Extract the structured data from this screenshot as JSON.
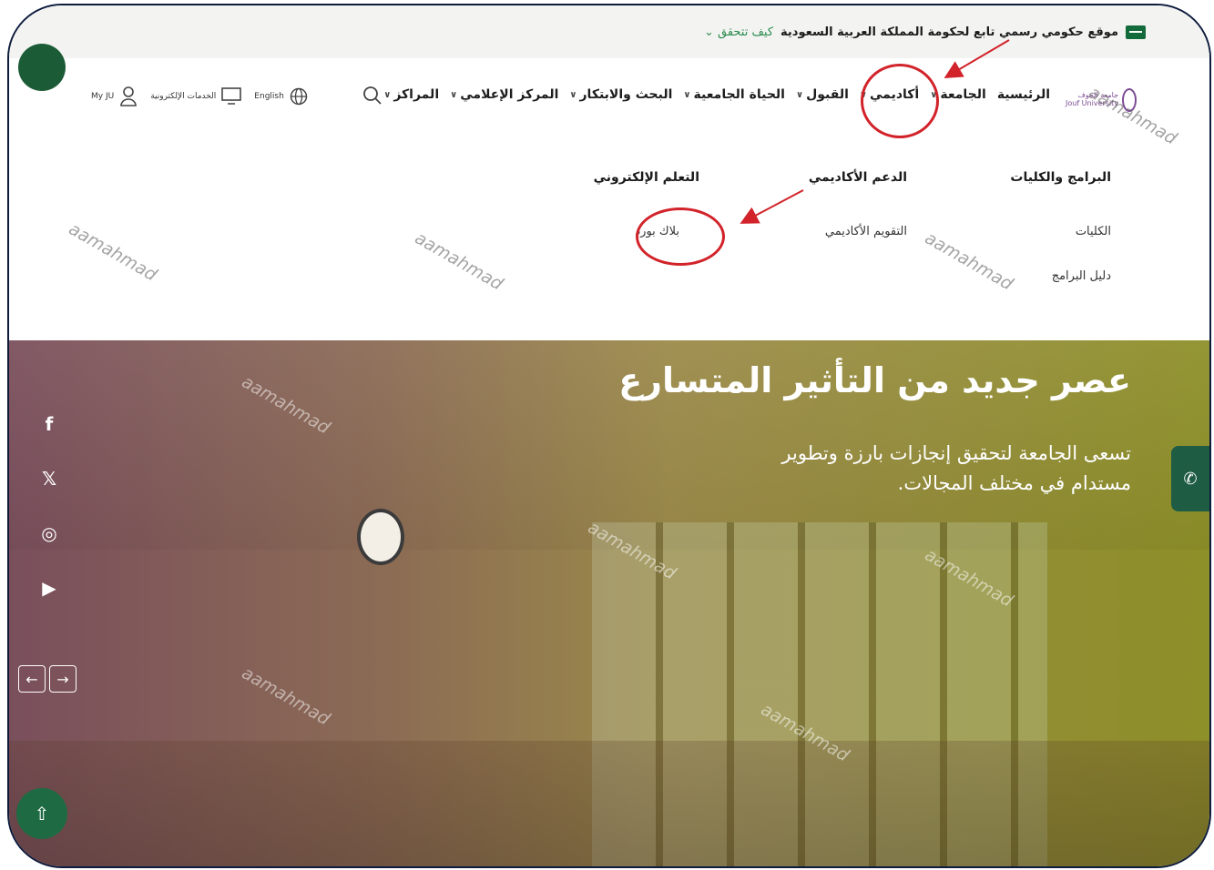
{
  "gov_bar": {
    "text": "موقع حكومي رسمي تابع لحكومة المملكة العربية السعودية",
    "link": "كيف تتحقق"
  },
  "header": {
    "logo_text": "جامعة الجوف\nJouf University",
    "nav": [
      {
        "label": "الرئيسية",
        "has_chevron": false
      },
      {
        "label": "الجامعة",
        "has_chevron": true
      },
      {
        "label": "أكاديمي",
        "has_chevron": true
      },
      {
        "label": "القبول",
        "has_chevron": true
      },
      {
        "label": "الحياة الجامعية",
        "has_chevron": true
      },
      {
        "label": "البحث والابتكار",
        "has_chevron": true
      },
      {
        "label": "المركز الإعلامي",
        "has_chevron": true
      },
      {
        "label": "المراكز",
        "has_chevron": true
      }
    ],
    "language": "English",
    "eservices": "الخدمات الإلكترونية",
    "myju": "My JU"
  },
  "mega_menu": {
    "columns": [
      {
        "title": "البرامج والكليات",
        "links": [
          "الكليات",
          "دليل البرامج"
        ]
      },
      {
        "title": "الدعم الأكاديمي",
        "links": [
          "التقويم الأكاديمي"
        ]
      },
      {
        "title": "التعلم الإلكتروني",
        "links": [
          "بلاك بورد"
        ]
      }
    ]
  },
  "hero": {
    "title": "عصر جديد من التأثير المتسارع",
    "subtitle": "تسعى الجامعة لتحقيق إنجازات بارزة وتطوير مستدام في مختلف المجالات."
  },
  "watermark": "aamahmad",
  "colors": {
    "accent": "#1e6b43",
    "annotation": "#d2232a",
    "logo": "#7b4b93"
  }
}
